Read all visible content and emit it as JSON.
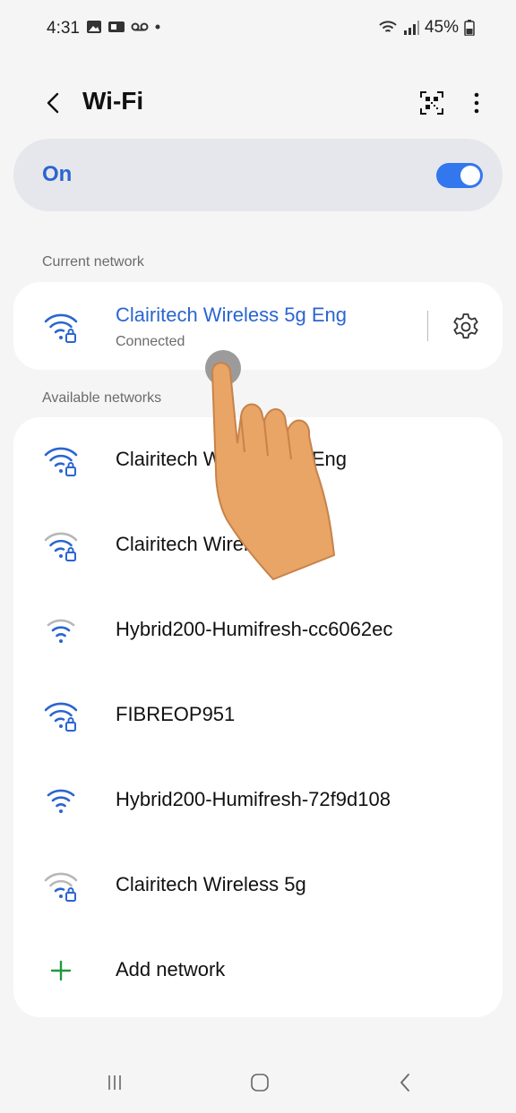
{
  "status_bar": {
    "time": "4:31",
    "battery": "45%"
  },
  "header": {
    "title": "Wi-Fi"
  },
  "wifi_toggle": {
    "label": "On",
    "state": "on"
  },
  "sections": {
    "current": "Current network",
    "available": "Available networks"
  },
  "current_network": {
    "name": "Clairitech Wireless 5g Eng",
    "status": "Connected"
  },
  "available_networks": [
    {
      "name": "Clairitech Wireless 5g Eng",
      "icon": "wifi-lock-icon"
    },
    {
      "name": "Clairitech Wireless",
      "icon": "wifi-lock-weak-icon"
    },
    {
      "name": "Hybrid200-Humifresh-cc6062ec",
      "icon": "wifi-open-icon"
    },
    {
      "name": "FIBREOP951",
      "icon": "wifi-lock-icon"
    },
    {
      "name": "Hybrid200-Humifresh-72f9d108",
      "icon": "wifi-open-icon"
    },
    {
      "name": "Clairitech Wireless 5g",
      "icon": "wifi-lock-weak-icon"
    }
  ],
  "add_network": {
    "label": "Add network"
  },
  "colors": {
    "accent": "#2a65d0",
    "toggle": "#3377ee",
    "add": "#1f9a3e"
  }
}
